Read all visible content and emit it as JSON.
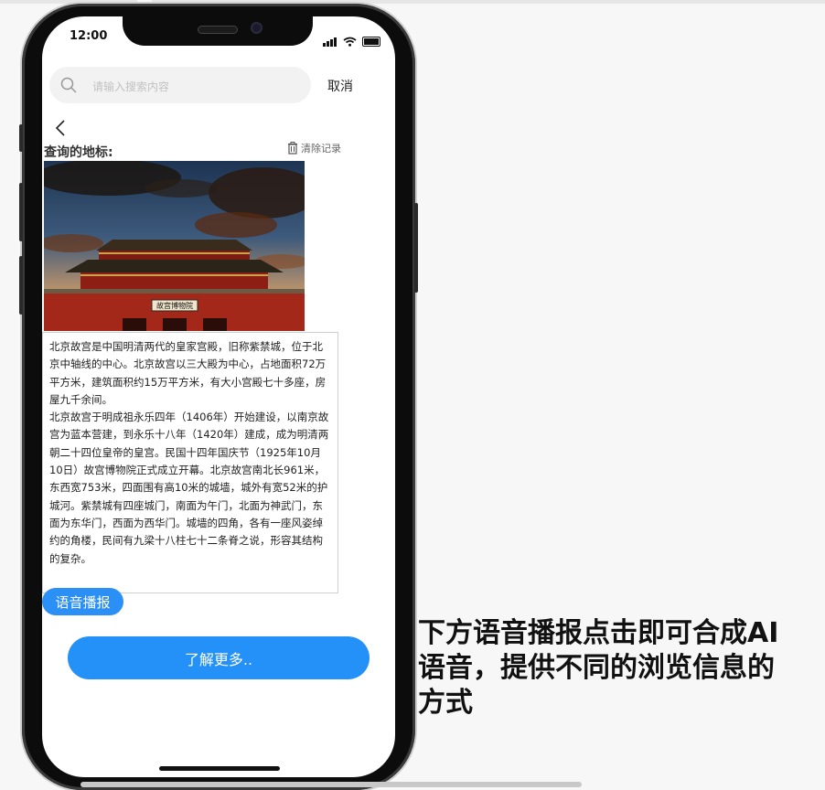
{
  "status_bar": {
    "time": "12:00"
  },
  "search": {
    "placeholder": "请输入搜索内容",
    "cancel_label": "取消"
  },
  "landmark": {
    "section_title": "查询的地标:",
    "clear_label": "清除记录",
    "plaque_text": "故宫博物院",
    "description": "北京故宫是中国明清两代的皇家宫殿，旧称紫禁城，位于北京中轴线的中心。北京故宫以三大殿为中心，占地面积72万平方米，建筑面积约15万平方米，有大小宫殿七十多座，房屋九千余间。\n北京故宫于明成祖永乐四年（1406年）开始建设，以南京故宫为蓝本营建，到永乐十八年（1420年）建成，成为明清两朝二十四位皇帝的皇宫。民国十四年国庆节（1925年10月10日）故宫博物院正式成立开幕。北京故宫南北长961米，东西宽753米，四面围有高10米的城墙，城外有宽52米的护城河。紫禁城有四座城门，南面为午门，北面为神武门，东面为东华门，西面为西华门。城墙的四角，各有一座风姿绰约的角楼，民间有九梁十八柱七十二条脊之说，形容其结构的复杂。"
  },
  "buttons": {
    "voice": "语音播报",
    "learn_more": "了解更多.."
  },
  "annotation": "下方语音播报点击即可合成AI语音，提供不同的浏览信息的方式",
  "colors": {
    "primary": "#2391f7",
    "phone_frame": "#0c0c0c"
  }
}
